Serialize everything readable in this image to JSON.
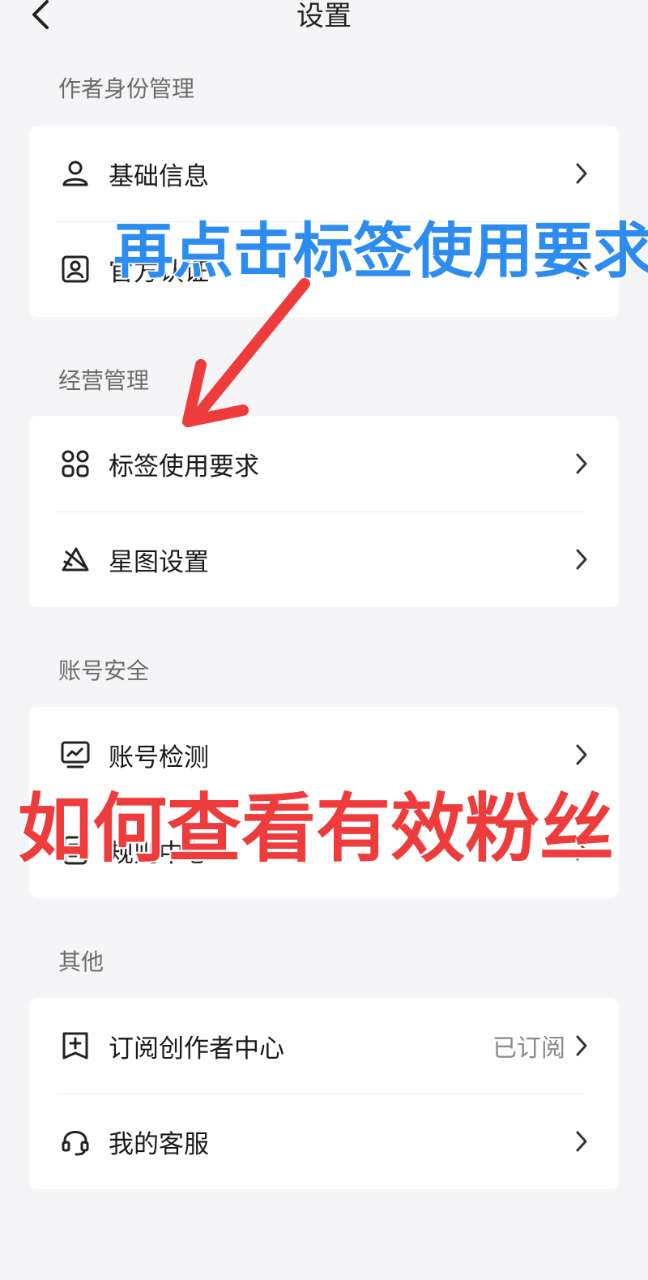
{
  "header": {
    "title": "设置"
  },
  "sections": [
    {
      "title": "作者身份管理",
      "items": [
        {
          "label": "基础信息",
          "icon": "user-icon"
        },
        {
          "label": "官方认证",
          "icon": "id-badge-icon"
        }
      ]
    },
    {
      "title": "经营管理",
      "items": [
        {
          "label": "标签使用要求",
          "icon": "grid-icon"
        },
        {
          "label": "星图设置",
          "icon": "star-map-icon"
        }
      ]
    },
    {
      "title": "账号安全",
      "items": [
        {
          "label": "账号检测",
          "icon": "monitor-chart-icon"
        },
        {
          "label": "规则中心",
          "icon": "document-icon"
        }
      ]
    },
    {
      "title": "其他",
      "items": [
        {
          "label": "订阅创作者中心",
          "value": "已订阅",
          "icon": "plus-bookmark-icon"
        },
        {
          "label": "我的客服",
          "icon": "headset-icon"
        }
      ]
    }
  ],
  "annotations": {
    "blue_caption": "再点击标签使用要求",
    "red_caption": "如何查看有效粉丝",
    "blue_color": "#2d8cf0",
    "red_color": "#ee3b3b"
  }
}
